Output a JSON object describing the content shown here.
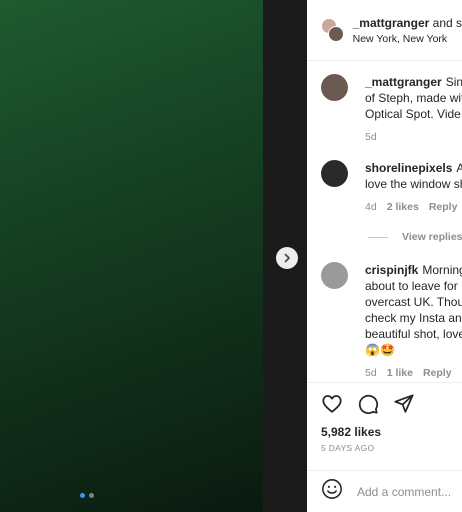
{
  "post": {
    "author": "_mattgranger",
    "author_suffix": "and s",
    "location": "New York, New York",
    "image_alt": "Photo"
  },
  "comments": [
    {
      "username": "_mattgranger",
      "lines": [
        "Sing",
        "of Steph, made wit",
        "Optical Spot. Vide"
      ],
      "time": "5d"
    },
    {
      "username": "shorelinepixels",
      "lines": [
        "Aw",
        "love the window sh"
      ],
      "time": "4d",
      "likes": "2 likes",
      "reply": "Reply"
    },
    {
      "username": "crispinjfk",
      "lines": [
        "Morning",
        "about to leave for",
        "overcast UK. Thoug",
        "check my Insta and",
        "beautiful shot, love"
      ],
      "emojis": "😱🤩",
      "time": "5d",
      "likes": "1 like",
      "reply": "Reply"
    }
  ],
  "view_replies": "View replies (",
  "likes": "5,982 likes",
  "posted_ago": "5 DAYS AGO",
  "comment_input": {
    "placeholder": "Add a comment..."
  },
  "carousel": {
    "current": 1,
    "total": 2
  },
  "colors": {
    "accent": "#3897f0",
    "muted": "#8e8e8e",
    "text": "#262626",
    "border": "#efefef"
  }
}
